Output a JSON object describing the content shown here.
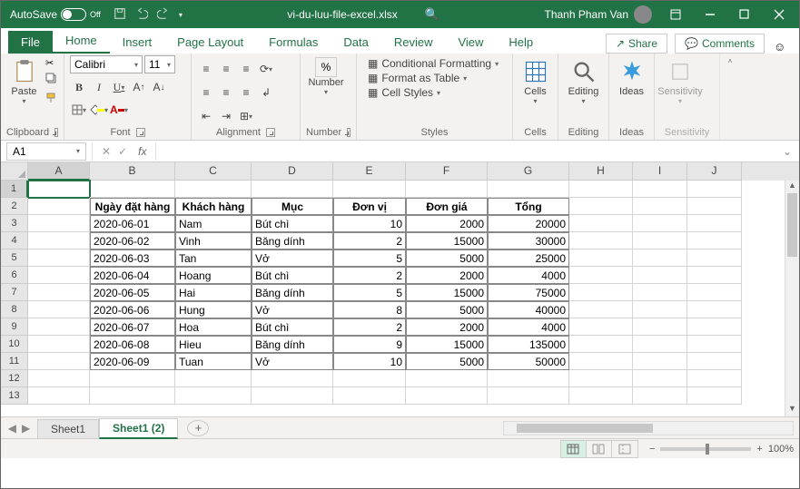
{
  "titlebar": {
    "autosave_label": "AutoSave",
    "autosave_state": "Off",
    "filename": "vi-du-luu-file-excel.xlsx",
    "username": "Thanh Pham Van"
  },
  "tabs": {
    "file": "File",
    "home": "Home",
    "insert": "Insert",
    "pagelayout": "Page Layout",
    "formulas": "Formulas",
    "data": "Data",
    "review": "Review",
    "view": "View",
    "help": "Help",
    "share": "Share",
    "comments": "Comments"
  },
  "ribbon": {
    "clipboard": "Clipboard",
    "paste": "Paste",
    "font": "Font",
    "font_name": "Calibri",
    "font_size": "11",
    "alignment": "Alignment",
    "number": "Number",
    "styles": "Styles",
    "cond_fmt": "Conditional Formatting",
    "fmt_table": "Format as Table",
    "cell_styles": "Cell Styles",
    "cells": "Cells",
    "editing": "Editing",
    "ideas": "Ideas",
    "sensitivity": "Sensitivity"
  },
  "formula": {
    "name_box": "A1",
    "fx": "fx"
  },
  "columns": [
    "A",
    "B",
    "C",
    "D",
    "E",
    "F",
    "G",
    "H",
    "I",
    "J"
  ],
  "headers": [
    "Ngày đặt hàng",
    "Khách hàng",
    "Mục",
    "Đơn vị",
    "Đơn giá",
    "Tổng"
  ],
  "rows": [
    {
      "d": "2020-06-01",
      "c": "Nam",
      "i": "Bút chì",
      "u": "10",
      "p": "2000",
      "t": "20000"
    },
    {
      "d": "2020-06-02",
      "c": "Vinh",
      "i": "Băng dính",
      "u": "2",
      "p": "15000",
      "t": "30000"
    },
    {
      "d": "2020-06-03",
      "c": "Tan",
      "i": "Vở",
      "u": "5",
      "p": "5000",
      "t": "25000"
    },
    {
      "d": "2020-06-04",
      "c": "Hoang",
      "i": "Bút chì",
      "u": "2",
      "p": "2000",
      "t": "4000"
    },
    {
      "d": "2020-06-05",
      "c": "Hai",
      "i": "Băng dính",
      "u": "5",
      "p": "15000",
      "t": "75000"
    },
    {
      "d": "2020-06-06",
      "c": "Hung",
      "i": "Vở",
      "u": "8",
      "p": "5000",
      "t": "40000"
    },
    {
      "d": "2020-06-07",
      "c": "Hoa",
      "i": "Bút chì",
      "u": "2",
      "p": "2000",
      "t": "4000"
    },
    {
      "d": "2020-06-08",
      "c": "Hieu",
      "i": "Băng dính",
      "u": "9",
      "p": "15000",
      "t": "135000"
    },
    {
      "d": "2020-06-09",
      "c": "Tuan",
      "i": "Vở",
      "u": "10",
      "p": "5000",
      "t": "50000"
    }
  ],
  "sheets": {
    "s1": "Sheet1",
    "s2": "Sheet1 (2)"
  },
  "status": {
    "zoom": "100%"
  }
}
